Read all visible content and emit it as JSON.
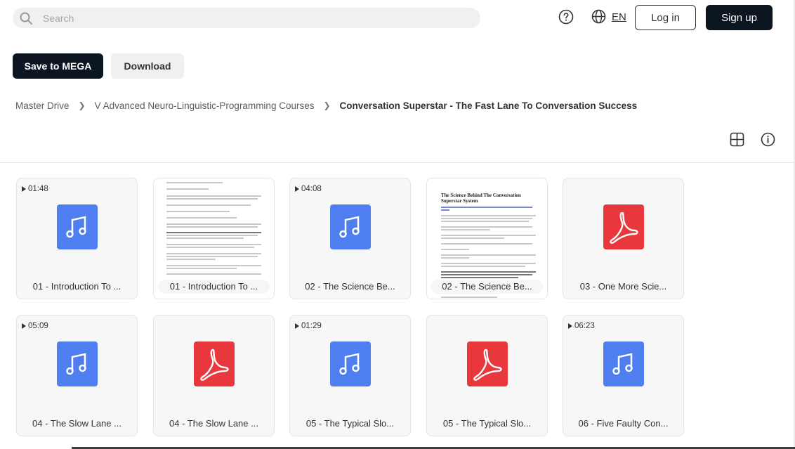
{
  "header": {
    "search_placeholder": "Search",
    "language": "EN",
    "login_label": "Log in",
    "signup_label": "Sign up"
  },
  "actions": {
    "save_label": "Save to MEGA",
    "download_label": "Download"
  },
  "breadcrumb": [
    "Master Drive",
    "V Advanced Neuro-Linguistic-Programming Courses",
    "Conversation Superstar - The Fast Lane To Conversation Success"
  ],
  "files": [
    {
      "name": "01 - Introduction To ...",
      "type": "audio",
      "duration": "01:48"
    },
    {
      "name": "01 - Introduction To ...",
      "type": "document-preview"
    },
    {
      "name": "02 - The Science Be...",
      "type": "audio",
      "duration": "04:08"
    },
    {
      "name": "02 - The Science Be...",
      "type": "document-preview",
      "preview_title": "The Science Behind The Conversation Superstar System"
    },
    {
      "name": "03 - One More Scie...",
      "type": "pdf"
    },
    {
      "name": "04 - The Slow Lane ...",
      "type": "audio",
      "duration": "05:09"
    },
    {
      "name": "04 - The Slow Lane ...",
      "type": "pdf"
    },
    {
      "name": "05 - The Typical Slo...",
      "type": "audio",
      "duration": "01:29"
    },
    {
      "name": "05 - The Typical Slo...",
      "type": "pdf"
    },
    {
      "name": "06 - Five Faulty Con...",
      "type": "audio",
      "duration": "06:23"
    }
  ],
  "colors": {
    "audio_icon": "#4f7ef0",
    "pdf_icon": "#e8383d",
    "primary_button": "#0c1620"
  }
}
